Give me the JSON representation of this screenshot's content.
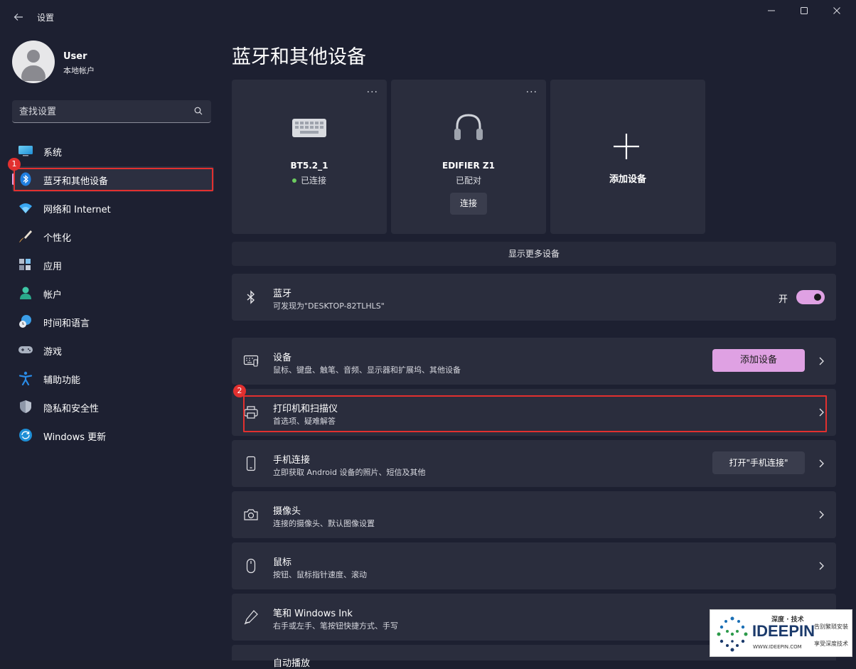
{
  "titlebar": {
    "title": "设置",
    "minimize": "—",
    "maximize": "☐",
    "close": "✕"
  },
  "user": {
    "name": "User",
    "account_type": "本地帐户"
  },
  "search": {
    "placeholder": "查找设置"
  },
  "sidebar": {
    "items": [
      {
        "label": "系统",
        "icon": "monitor-icon"
      },
      {
        "label": "蓝牙和其他设备",
        "icon": "bluetooth-icon",
        "active": true
      },
      {
        "label": "网络和 Internet",
        "icon": "wifi-icon"
      },
      {
        "label": "个性化",
        "icon": "brush-icon"
      },
      {
        "label": "应用",
        "icon": "apps-icon"
      },
      {
        "label": "帐户",
        "icon": "account-icon"
      },
      {
        "label": "时间和语言",
        "icon": "globe-clock-icon"
      },
      {
        "label": "游戏",
        "icon": "gamepad-icon"
      },
      {
        "label": "辅助功能",
        "icon": "accessibility-icon"
      },
      {
        "label": "隐私和安全性",
        "icon": "shield-icon"
      },
      {
        "label": "Windows 更新",
        "icon": "update-icon"
      }
    ]
  },
  "annotations": {
    "badge1": "1",
    "badge2": "2"
  },
  "main": {
    "title": "蓝牙和其他设备",
    "devices": [
      {
        "name": "BT5.2_1",
        "status": "已连接",
        "icon": "keyboard-icon",
        "more": "···"
      },
      {
        "name": "EDIFIER Z1",
        "status": "已配对",
        "icon": "headset-icon",
        "more": "···",
        "action": "连接"
      }
    ],
    "add_device_tile": "添加设备",
    "show_more": "显示更多设备",
    "bluetooth": {
      "title": "蓝牙",
      "subtitle": "可发现为\"DESKTOP-82TLHLS\"",
      "toggle_label": "开",
      "on": true
    },
    "cards": {
      "devices": {
        "title": "设备",
        "subtitle": "鼠标、键盘、触笔、音频、显示器和扩展坞、其他设备",
        "button": "添加设备"
      },
      "printers": {
        "title": "打印机和扫描仪",
        "subtitle": "首选项、疑难解答"
      },
      "phone": {
        "title": "手机连接",
        "subtitle": "立即获取 Android 设备的照片、短信及其他",
        "button": "打开\"手机连接\""
      },
      "camera": {
        "title": "摄像头",
        "subtitle": "连接的摄像头、默认图像设置"
      },
      "mouse": {
        "title": "鼠标",
        "subtitle": "按钮、鼠标指针速度、滚动"
      },
      "pen": {
        "title": "笔和 Windows Ink",
        "subtitle": "右手或左手、笔按钮快捷方式、手写"
      },
      "autoplay": {
        "title": "自动播放"
      }
    }
  },
  "watermark": {
    "top": "深度 · 技术",
    "brand": "IDEEPIN",
    "url": "WWW.IDEEPIN.COM",
    "side1": "告别繁琐安装",
    "side2": "享受深度技术"
  },
  "colors": {
    "accent": "#dfa1e3",
    "annotation_red": "#e2302f",
    "connected_green": "#6ccb5f"
  }
}
